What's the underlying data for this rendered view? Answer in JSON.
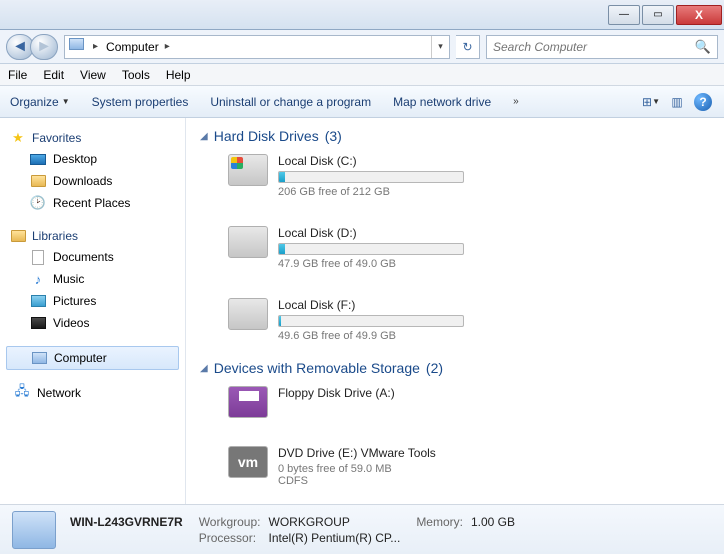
{
  "window": {
    "minimize": "—",
    "maximize": "▭",
    "close": "X"
  },
  "nav": {
    "location_label": "Computer",
    "search_placeholder": "Search Computer"
  },
  "menu": {
    "file": "File",
    "edit": "Edit",
    "view": "View",
    "tools": "Tools",
    "help": "Help"
  },
  "toolbar": {
    "organize": "Organize",
    "system_properties": "System properties",
    "uninstall": "Uninstall or change a program",
    "map_drive": "Map network drive",
    "more": "»"
  },
  "sidebar": {
    "favorites": {
      "label": "Favorites",
      "items": [
        {
          "label": "Desktop",
          "icon": "desktop-icon"
        },
        {
          "label": "Downloads",
          "icon": "folder-icon"
        },
        {
          "label": "Recent Places",
          "icon": "recent-icon"
        }
      ]
    },
    "libraries": {
      "label": "Libraries",
      "items": [
        {
          "label": "Documents",
          "icon": "documents-icon"
        },
        {
          "label": "Music",
          "icon": "music-icon"
        },
        {
          "label": "Pictures",
          "icon": "pictures-icon"
        },
        {
          "label": "Videos",
          "icon": "videos-icon"
        }
      ]
    },
    "computer": {
      "label": "Computer"
    },
    "network": {
      "label": "Network"
    }
  },
  "categories": {
    "hdd": {
      "label": "Hard Disk Drives",
      "count": "(3)"
    },
    "removable": {
      "label": "Devices with Removable Storage",
      "count": "(2)"
    }
  },
  "drives": {
    "hdd": [
      {
        "name": "Local Disk (C:)",
        "free_text": "206 GB free of 212 GB",
        "fill_pct": 3,
        "icon": "os"
      },
      {
        "name": "Local Disk (D:)",
        "free_text": "47.9 GB free of 49.0 GB",
        "fill_pct": 3,
        "icon": ""
      },
      {
        "name": "Local Disk (F:)",
        "free_text": "49.6 GB free of 49.9 GB",
        "fill_pct": 1,
        "icon": ""
      }
    ],
    "removable": [
      {
        "name": "Floppy Disk Drive (A:)",
        "free_text": "",
        "sub": "",
        "icon": "floppy"
      },
      {
        "name": "DVD Drive (E:) VMware Tools",
        "free_text": "0 bytes free of 59.0 MB",
        "sub": "CDFS",
        "icon": "vm",
        "icon_text": "vm"
      }
    ]
  },
  "status": {
    "name": "WIN-L243GVRNE7R",
    "workgroup_label": "Workgroup:",
    "workgroup": "WORKGROUP",
    "memory_label": "Memory:",
    "memory": "1.00 GB",
    "processor_label": "Processor:",
    "processor": "Intel(R) Pentium(R) CP..."
  }
}
